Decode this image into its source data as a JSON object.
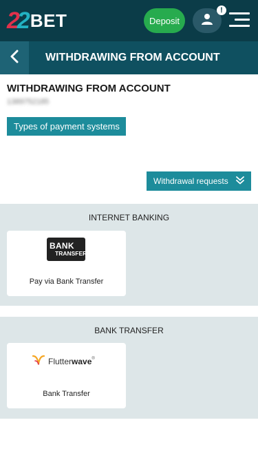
{
  "header": {
    "logo_number": "22",
    "logo_text": "BET",
    "deposit_label": "Deposit",
    "notification_count": "!"
  },
  "subheader": {
    "title": "WITHDRAWING FROM ACCOUNT"
  },
  "panel": {
    "title": "WITHDRAWING FROM ACCOUNT",
    "account_id": "1389752185",
    "payment_types_label": "Types of payment systems",
    "withdrawal_requests_label": "Withdrawal requests"
  },
  "sections": [
    {
      "title": "INTERNET BANKING",
      "cards": [
        {
          "logo_line1": "BANK",
          "logo_line2": "TRANSFER",
          "label": "Pay via Bank Transfer"
        }
      ]
    },
    {
      "title": "BANK TRANSFER",
      "cards": [
        {
          "logo_part1": "Flutter",
          "logo_part2": "wave",
          "logo_reg": "®",
          "label": "Bank Transfer"
        }
      ]
    }
  ],
  "colors": {
    "header_bg": "#0b3c48",
    "subheader_bg": "#0f5060",
    "accent": "#1d8c9b",
    "deposit": "#27ab4e",
    "section_bg": "#dde6e8"
  }
}
